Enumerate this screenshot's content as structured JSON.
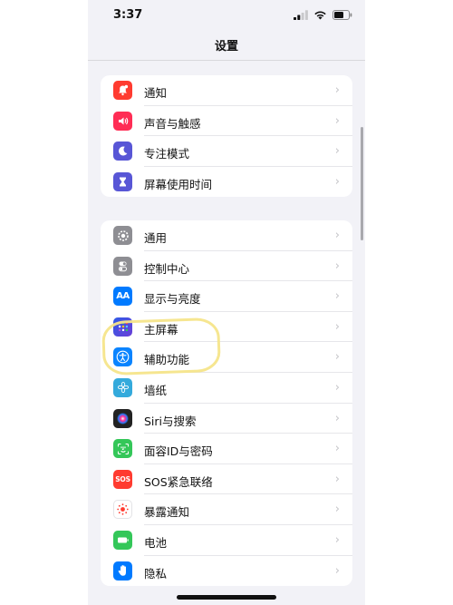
{
  "status_bar": {
    "time": "3:37"
  },
  "nav": {
    "title": "设置"
  },
  "group1": [
    {
      "label": "通知",
      "icon": "bell-badge-icon",
      "color": "#ff3b30"
    },
    {
      "label": "声音与触感",
      "icon": "speaker-icon",
      "color": "#ff2d55"
    },
    {
      "label": "专注模式",
      "icon": "moon-icon",
      "color": "#5856d6"
    },
    {
      "label": "屏幕使用时间",
      "icon": "hourglass-icon",
      "color": "#5856d6"
    }
  ],
  "group2": [
    {
      "label": "通用",
      "icon": "gear-icon",
      "color": "#8e8e93"
    },
    {
      "label": "控制中心",
      "icon": "toggles-icon",
      "color": "#8e8e93"
    },
    {
      "label": "显示与亮度",
      "icon": "text-size-icon",
      "color": "#007aff",
      "glyph": "AA"
    },
    {
      "label": "主屏幕",
      "icon": "home-grid-icon",
      "color": "#2f5be7"
    },
    {
      "label": "辅助功能",
      "icon": "accessibility-icon",
      "color": "#0a84ff"
    },
    {
      "label": "墙纸",
      "icon": "flower-icon",
      "color": "#34aadc"
    },
    {
      "label": "Siri与搜索",
      "icon": "siri-icon",
      "color": "#222222"
    },
    {
      "label": "面容ID与密码",
      "icon": "face-id-icon",
      "color": "#34c759"
    },
    {
      "label": "SOS紧急联络",
      "icon": "sos-icon",
      "color": "#ff3b30",
      "glyph": "SOS"
    },
    {
      "label": "暴露通知",
      "icon": "exposure-icon",
      "color": "#ffffff"
    },
    {
      "label": "电池",
      "icon": "battery-icon",
      "color": "#34c759"
    },
    {
      "label": "隐私",
      "icon": "hand-icon",
      "color": "#007aff"
    }
  ]
}
